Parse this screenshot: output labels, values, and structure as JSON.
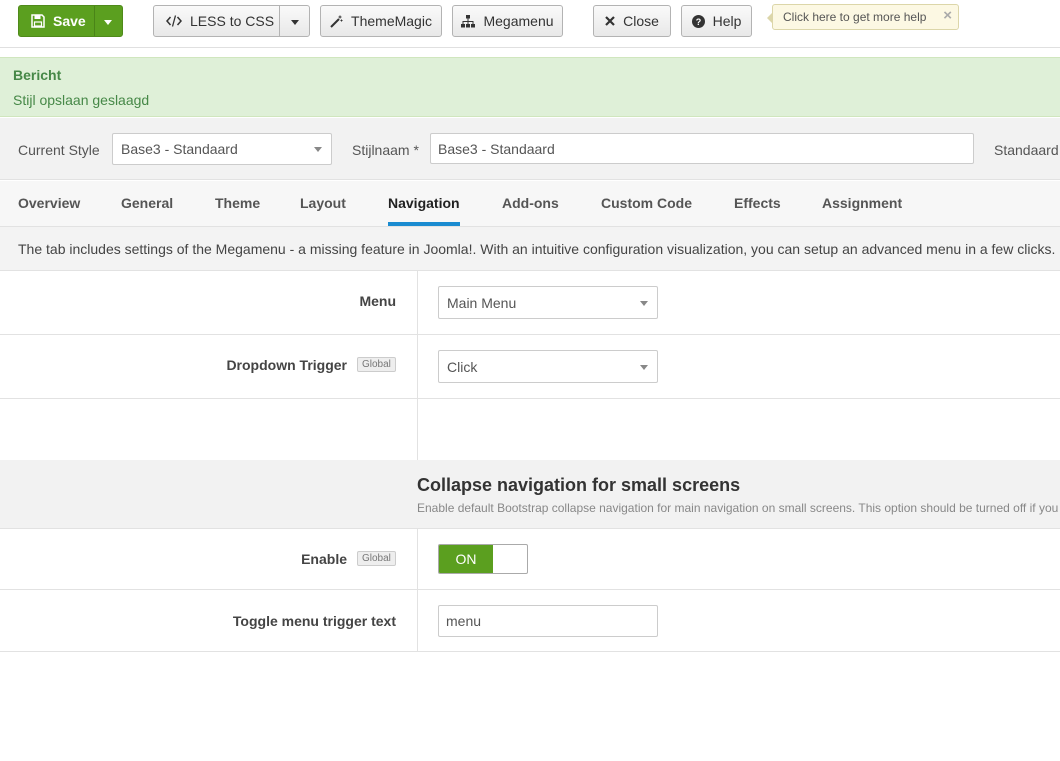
{
  "toolbar": {
    "save_label": "Save",
    "less_label": "LESS to CSS",
    "thememagic_label": "ThemeMagic",
    "megamenu_label": "Megamenu",
    "close_label": "Close",
    "help_label": "Help",
    "help_tip": "Click here to get more help",
    "help_tip_close": "×"
  },
  "message": {
    "heading": "Bericht",
    "text": "Stijl opslaan geslaagd"
  },
  "style_bar": {
    "current_style_label": "Current Style",
    "current_style_value": "Base3 - Standaard",
    "name_label": "Stijlnaam *",
    "name_value": "Base3 - Standaard",
    "default_label": "Standaard"
  },
  "tabs": [
    {
      "label": "Overview"
    },
    {
      "label": "General"
    },
    {
      "label": "Theme"
    },
    {
      "label": "Layout"
    },
    {
      "label": "Navigation"
    },
    {
      "label": "Add-ons"
    },
    {
      "label": "Custom Code"
    },
    {
      "label": "Effects"
    },
    {
      "label": "Assignment"
    }
  ],
  "active_tab": "Navigation",
  "description": "The tab includes settings of the Megamenu - a missing feature in Joomla!. With an intuitive configuration visualization, you can setup an advanced menu in a few clicks.",
  "form": {
    "menu_label": "Menu",
    "menu_value": "Main Menu",
    "dropdown_label": "Dropdown Trigger",
    "dropdown_badge": "Global",
    "dropdown_value": "Click",
    "section_title": "Collapse navigation for small screens",
    "section_desc": "Enable default Bootstrap collapse navigation for main navigation on small screens. This option should be turned off if you",
    "enable_label": "Enable",
    "enable_badge": "Global",
    "enable_state": "ON",
    "toggle_text_label": "Toggle menu trigger text",
    "toggle_text_value": "menu"
  },
  "colors": {
    "primary_green": "#5b9f1f",
    "active_tab_underline": "#1a8bd0",
    "success_bg": "#dff0d8",
    "success_text": "#468847"
  }
}
